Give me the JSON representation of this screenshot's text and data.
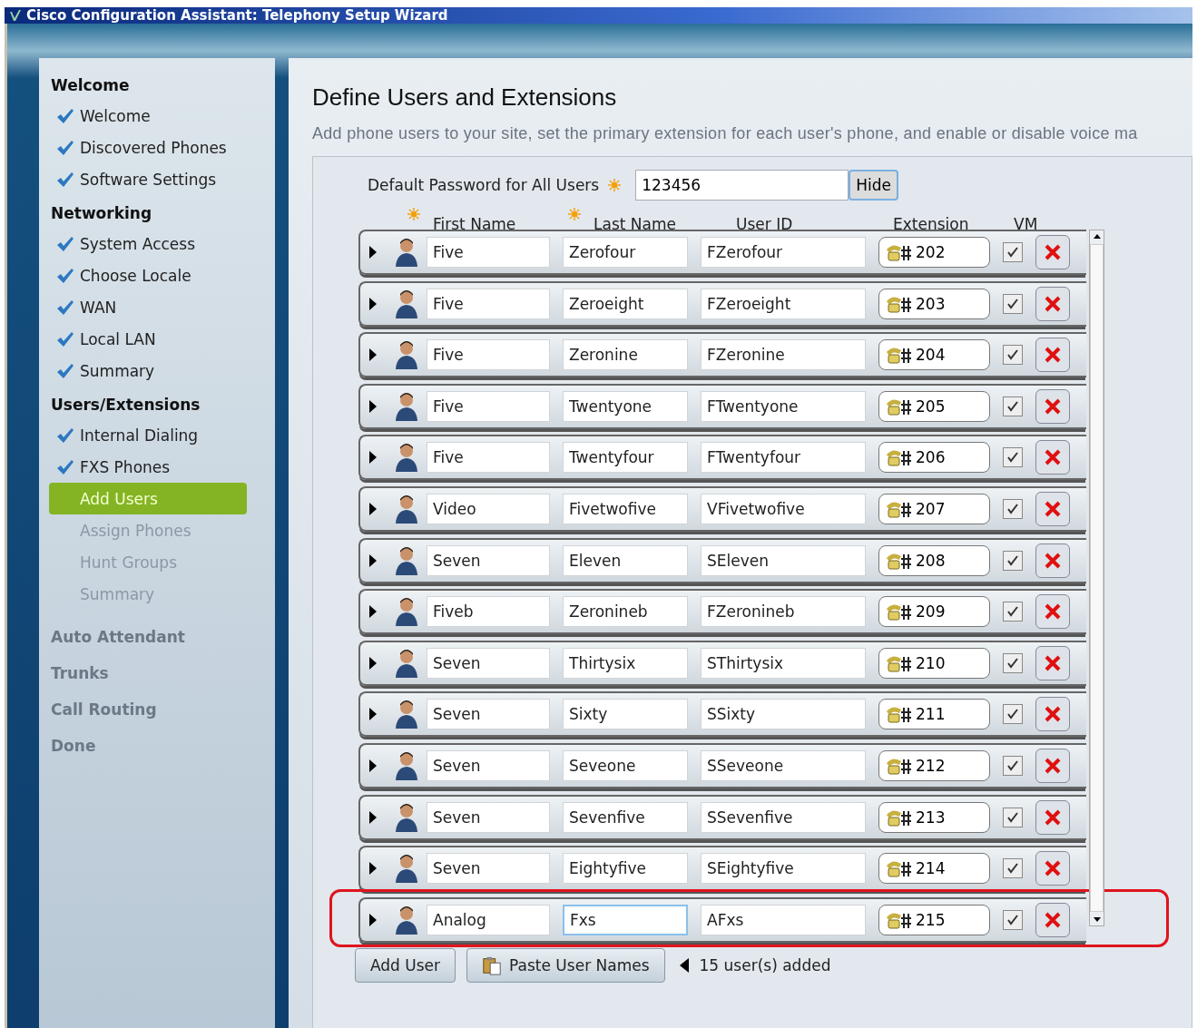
{
  "window": {
    "title": "Cisco Configuration Assistant: Telephony Setup Wizard"
  },
  "sidebar": {
    "sections": [
      {
        "title": "Welcome",
        "enabled": true,
        "items": [
          {
            "label": "Welcome",
            "done": true,
            "selected": false,
            "enabled": true
          },
          {
            "label": "Discovered Phones",
            "done": true,
            "selected": false,
            "enabled": true
          },
          {
            "label": "Software Settings",
            "done": true,
            "selected": false,
            "enabled": true
          }
        ]
      },
      {
        "title": "Networking",
        "enabled": true,
        "items": [
          {
            "label": "System Access",
            "done": true,
            "selected": false,
            "enabled": true
          },
          {
            "label": "Choose Locale",
            "done": true,
            "selected": false,
            "enabled": true
          },
          {
            "label": "WAN",
            "done": true,
            "selected": false,
            "enabled": true
          },
          {
            "label": "Local LAN",
            "done": true,
            "selected": false,
            "enabled": true
          },
          {
            "label": "Summary",
            "done": true,
            "selected": false,
            "enabled": true
          }
        ]
      },
      {
        "title": "Users/Extensions",
        "enabled": true,
        "items": [
          {
            "label": "Internal Dialing",
            "done": true,
            "selected": false,
            "enabled": true
          },
          {
            "label": "FXS Phones",
            "done": true,
            "selected": false,
            "enabled": true
          },
          {
            "label": "Add Users",
            "done": false,
            "selected": true,
            "enabled": true
          },
          {
            "label": "Assign Phones",
            "done": false,
            "selected": false,
            "enabled": false
          },
          {
            "label": "Hunt Groups",
            "done": false,
            "selected": false,
            "enabled": false
          },
          {
            "label": "Summary",
            "done": false,
            "selected": false,
            "enabled": false
          }
        ]
      },
      {
        "title": "Auto Attendant",
        "enabled": false
      },
      {
        "title": "Trunks",
        "enabled": false
      },
      {
        "title": "Call Routing",
        "enabled": false
      },
      {
        "title": "Done",
        "enabled": false
      }
    ]
  },
  "page": {
    "heading": "Define Users and Extensions",
    "description": "Add phone users to your site, set the primary extension for each user's phone, and enable or disable voice ma"
  },
  "password": {
    "label": "Default Password for All Users",
    "required": true,
    "value": "123456",
    "button": "Hide"
  },
  "columns": [
    {
      "label": "First Name",
      "required": true
    },
    {
      "label": "Last Name",
      "required": true
    },
    {
      "label": "User ID",
      "required": false
    },
    {
      "label": "Extension",
      "required": false
    },
    {
      "label": "VM",
      "required": false
    }
  ],
  "rows": [
    {
      "first_name": "Five",
      "last_name": "Zerofour",
      "user_id": "FZerofour",
      "extension": "202",
      "vm": true,
      "outlined": false
    },
    {
      "first_name": "Five",
      "last_name": "Zeroeight",
      "user_id": "FZeroeight",
      "extension": "203",
      "vm": true,
      "outlined": false
    },
    {
      "first_name": "Five",
      "last_name": "Zeronine",
      "user_id": "FZeronine",
      "extension": "204",
      "vm": true,
      "outlined": false
    },
    {
      "first_name": "Five",
      "last_name": "Twentyone",
      "user_id": "FTwentyone",
      "extension": "205",
      "vm": true,
      "outlined": false
    },
    {
      "first_name": "Five",
      "last_name": "Twentyfour",
      "user_id": "FTwentyfour",
      "extension": "206",
      "vm": true,
      "outlined": false
    },
    {
      "first_name": "Video",
      "last_name": "Fivetwofive",
      "user_id": "VFivetwofive",
      "extension": "207",
      "vm": true,
      "outlined": false
    },
    {
      "first_name": "Seven",
      "last_name": "Eleven",
      "user_id": "SEleven",
      "extension": "208",
      "vm": true,
      "outlined": false
    },
    {
      "first_name": "Fiveb",
      "last_name": "Zeronineb",
      "user_id": "FZeronineb",
      "extension": "209",
      "vm": true,
      "outlined": false
    },
    {
      "first_name": "Seven",
      "last_name": "Thirtysix",
      "user_id": "SThirtysix",
      "extension": "210",
      "vm": true,
      "outlined": false
    },
    {
      "first_name": "Seven",
      "last_name": "Sixty",
      "user_id": "SSixty",
      "extension": "211",
      "vm": true,
      "outlined": false
    },
    {
      "first_name": "Seven",
      "last_name": "Seveone",
      "user_id": "SSeveone",
      "extension": "212",
      "vm": true,
      "outlined": false
    },
    {
      "first_name": "Seven",
      "last_name": "Sevenfive",
      "user_id": "SSevenfive",
      "extension": "213",
      "vm": true,
      "outlined": false
    },
    {
      "first_name": "Seven",
      "last_name": "Eightyfive",
      "user_id": "SEightyfive",
      "extension": "214",
      "vm": true,
      "outlined": false
    },
    {
      "first_name": "Analog",
      "last_name": "Fxs",
      "user_id": "AFxs",
      "extension": "215",
      "vm": true,
      "outlined": true
    }
  ],
  "buttons": [
    "Add User",
    "Paste User Names"
  ],
  "status": "15 user(s) added"
}
